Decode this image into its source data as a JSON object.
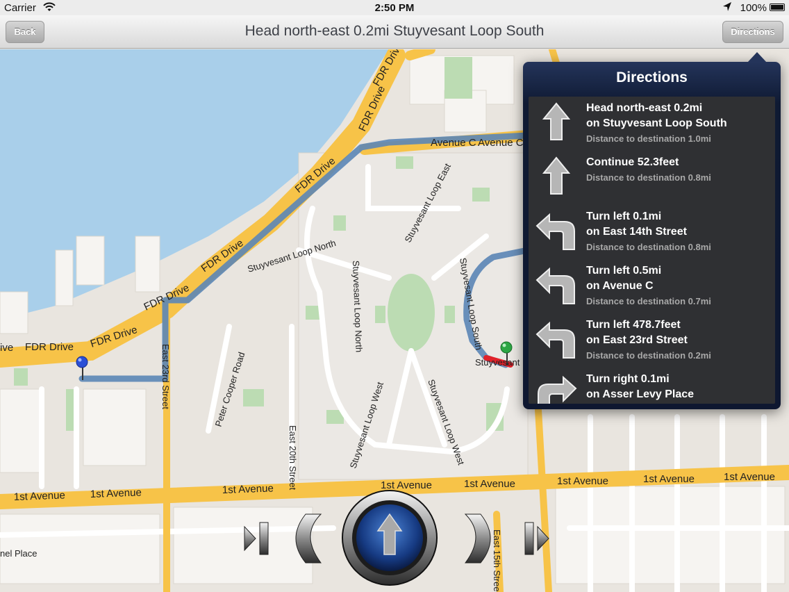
{
  "status_bar": {
    "carrier": "Carrier",
    "time": "2:50 PM",
    "battery": "100%"
  },
  "nav_bar": {
    "back_label": "Back",
    "title": "Head north-east 0.2mi Stuyvesant Loop South",
    "directions_label": "Directions"
  },
  "map": {
    "labels": {
      "avenue_c": "Avenue C",
      "avenue_c_2": "Avenue C",
      "fdr_1": "FDR Drive",
      "fdr_2": "FDR Drive",
      "fdr_3": "FDR Drive",
      "fdr_4": "FDR Drive",
      "fdr_5": "FDR Drive",
      "fdr_6": "FDR Drive",
      "fdr_7": "FDR Drive",
      "fdr_8": "FDR Drive",
      "fdr_9": "ive",
      "stuy_north": "Stuyvesant Loop North",
      "stuy_east": "Stuyvesant Loop East",
      "stuy_south": "Stuyvesant Loop South",
      "stuy_north_v": "Stuyvesant Loop North",
      "stuy_west_1": "Stuyvesant Loop West",
      "stuy_west_2": "Stuyvesant Loop West",
      "stuy_partial": "Stuyvesant",
      "east_23": "East 23rd Street",
      "peter_cooper": "Peter Cooper Road",
      "east_20": "East 20th Street",
      "east_15": "East 15th Street",
      "first_ave_1": "1st Avenue",
      "first_ave_2": "1st Avenue",
      "first_ave_3": "1st Avenue",
      "first_ave_4": "1st Avenue",
      "first_ave_5": "1st Avenue",
      "first_ave_6": "1st Avenue",
      "first_ave_7": "1st Avenue",
      "first_ave_8": "1st Avenue",
      "mel_place": "nel Place"
    }
  },
  "directions_popover": {
    "title": "Directions",
    "steps": [
      {
        "icon": "arrow-up-icon",
        "line1": "Head north-east 0.2mi",
        "line2": "on Stuyvesant Loop South",
        "distance": "Distance to destination 1.0mi"
      },
      {
        "icon": "arrow-up-icon",
        "line1": "Continue 52.3feet",
        "line2": "",
        "distance": "Distance to destination 0.8mi"
      },
      {
        "icon": "turn-left-icon",
        "line1": "Turn left 0.1mi",
        "line2": "on East 14th Street",
        "distance": "Distance to destination 0.8mi"
      },
      {
        "icon": "turn-left-icon",
        "line1": "Turn left 0.5mi",
        "line2": "on Avenue C",
        "distance": "Distance to destination 0.7mi"
      },
      {
        "icon": "turn-left-icon",
        "line1": "Turn left 478.7feet",
        "line2": "on East 23rd Street",
        "distance": "Distance to destination 0.2mi"
      },
      {
        "icon": "turn-right-icon",
        "line1": "Turn right 0.1mi",
        "line2": "on Asser Levy Place",
        "distance": ""
      }
    ]
  },
  "colors": {
    "water": "#a9cfea",
    "land": "#e9e5df",
    "highway": "#f7c348",
    "route": "#5b86b6",
    "park": "#bcdcb3",
    "popover": "#0f1a33"
  }
}
